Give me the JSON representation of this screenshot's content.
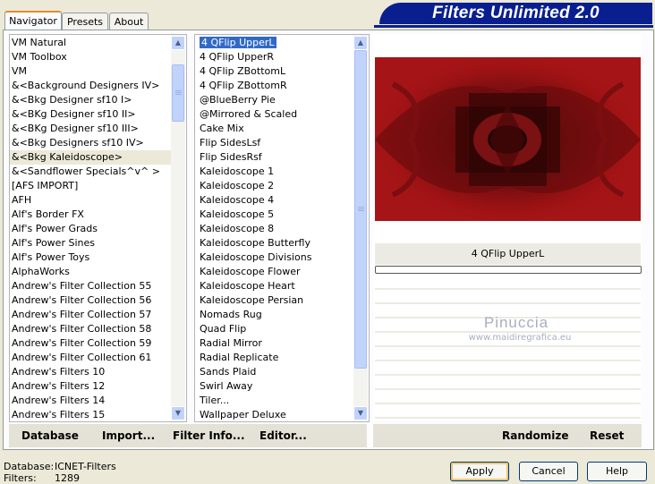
{
  "title": "Filters Unlimited 2.0",
  "tabs": [
    {
      "label": "Navigator",
      "active": true
    },
    {
      "label": "Presets",
      "active": false
    },
    {
      "label": "About",
      "active": false
    }
  ],
  "categories": [
    "VM Natural",
    "VM Toolbox",
    "VM",
    "&<Background Designers IV>",
    "&<Bkg Designer sf10 I>",
    "&<BKg Designer sf10 II>",
    "&<BKg Designer sf10 III>",
    "&<Bkg Designers sf10 IV>",
    "&<Bkg Kaleidoscope>",
    "&<Sandflower Specials^v^ >",
    "[AFS IMPORT]",
    "AFH",
    "Alf's Border FX",
    "Alf's Power Grads",
    "Alf's Power Sines",
    "Alf's Power Toys",
    "AlphaWorks",
    "Andrew's Filter Collection 55",
    "Andrew's Filter Collection 56",
    "Andrew's Filter Collection 57",
    "Andrew's Filter Collection 58",
    "Andrew's Filter Collection 59",
    "Andrew's Filter Collection 61",
    "Andrew's Filters 10",
    "Andrew's Filters 12",
    "Andrew's Filters 14",
    "Andrew's Filters 15"
  ],
  "selected_category_index": 8,
  "filters": [
    "4 QFlip UpperL",
    "4 QFlip UpperR",
    "4 QFlip ZBottomL",
    "4 QFlip ZBottomR",
    "@BlueBerry Pie",
    "@Mirrored & Scaled",
    "Cake Mix",
    "Flip SidesLsf",
    "Flip SidesRsf",
    "Kaleidoscope 1",
    "Kaleidoscope 2",
    "Kaleidoscope 4",
    "Kaleidoscope 5",
    "Kaleidoscope 8",
    "Kaleidoscope Butterfly",
    "Kaleidoscope Divisions",
    "Kaleidoscope Flower",
    "Kaleidoscope Heart",
    "Kaleidoscope Persian",
    "Nomads Rug",
    "Quad Flip",
    "Radial Mirror",
    "Radial Replicate",
    "Sands Plaid",
    "Swirl Away",
    "Tiler...",
    "Wallpaper Deluxe"
  ],
  "selected_filter_index": 0,
  "preview": {
    "filter_name": "4 QFlip UpperL",
    "watermark_name": "Pinuccia",
    "watermark_url": "www.maidiregrafica.eu"
  },
  "toolbar": {
    "database": "Database",
    "import": "Import...",
    "filter_info": "Filter Info...",
    "editor": "Editor...",
    "randomize": "Randomize",
    "reset": "Reset"
  },
  "status": {
    "database_label": "Database:",
    "database_value": "ICNET-Filters",
    "filters_label": "Filters:",
    "filters_value": "1289"
  },
  "buttons": {
    "apply": "Apply",
    "cancel": "Cancel",
    "help": "Help"
  }
}
